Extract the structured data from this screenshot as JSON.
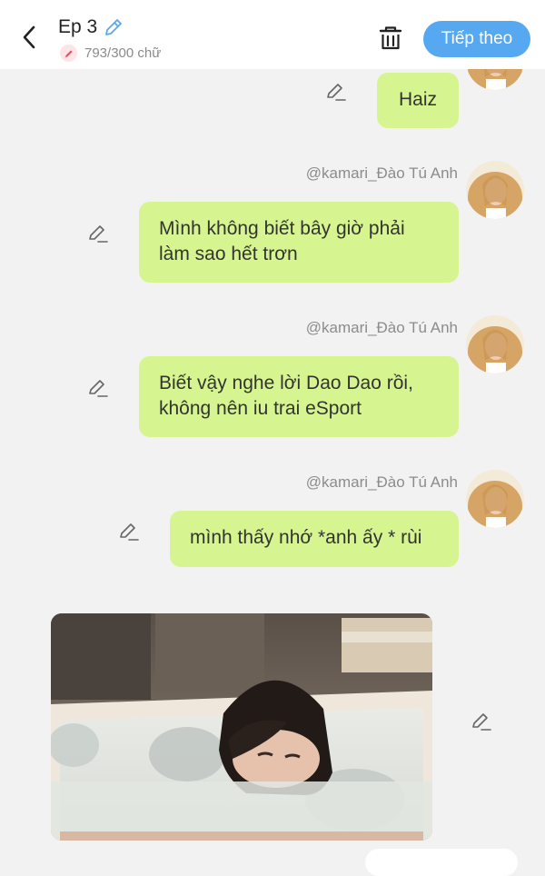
{
  "header": {
    "title": "Ep 3",
    "word_count": "793/300 chữ",
    "next_label": "Tiếp theo"
  },
  "messages": [
    {
      "text": "Haiz"
    },
    {
      "sender": "@kamari_Đào Tú Anh",
      "text": "Mình không biết bây giờ phải làm sao hết trơn"
    },
    {
      "sender": "@kamari_Đào Tú Anh",
      "text": "Biết vậy nghe lời Dao Dao rồi, không nên iu trai eSport"
    },
    {
      "sender": "@kamari_Đào Tú Anh",
      "text": "mình thấy nhớ *anh ấy * rùi"
    }
  ],
  "colors": {
    "accent": "#56a8f1",
    "bubble": "#d6f590",
    "background": "#f2f2f2"
  }
}
